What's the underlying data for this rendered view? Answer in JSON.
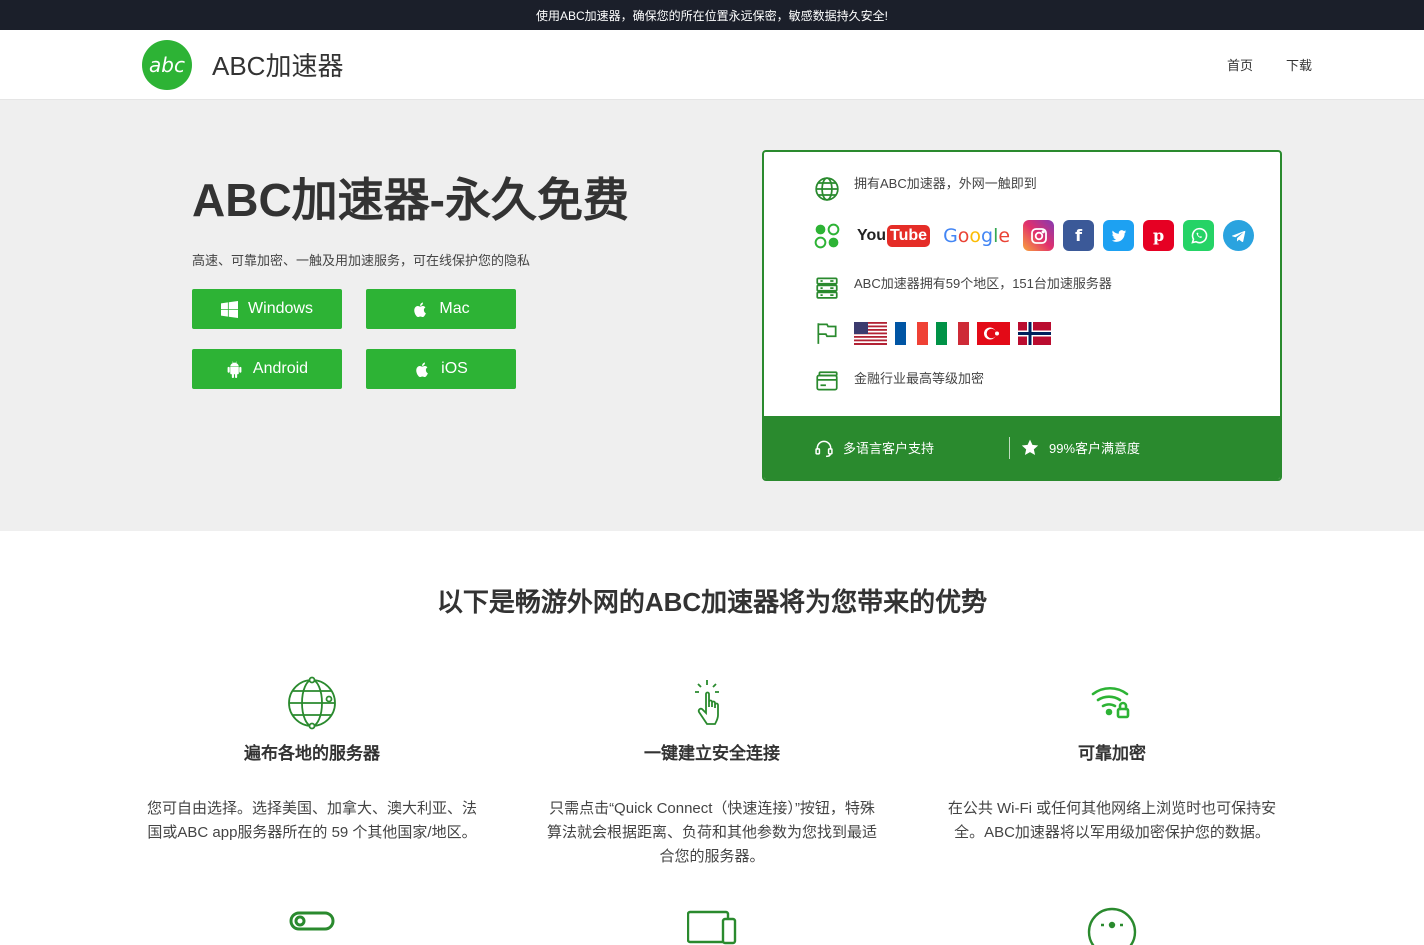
{
  "topbar": {
    "text": "使用ABC加速器，确保您的所在位置永远保密，敏感数据持久安全!"
  },
  "header": {
    "logo_text": "abc",
    "brand": "ABC加速器",
    "nav": [
      {
        "label": "首页"
      },
      {
        "label": "下载"
      }
    ]
  },
  "hero": {
    "title": "ABC加速器-永久免费",
    "subtitle": "高速、可靠加密、一触及用加速服务，可在线保护您的隐私",
    "buttons": [
      {
        "label": "Windows",
        "icon": "windows-icon"
      },
      {
        "label": "Mac",
        "icon": "apple-icon"
      },
      {
        "label": "Android",
        "icon": "android-icon"
      },
      {
        "label": "iOS",
        "icon": "apple-icon"
      }
    ]
  },
  "card": {
    "feature1": "拥有ABC加速器，外网一触即到",
    "social": [
      "YouTube",
      "Google",
      "Instagram",
      "Facebook",
      "Twitter",
      "Pinterest",
      "WhatsApp",
      "Telegram"
    ],
    "youtube_you": "You",
    "youtube_tube": "Tube",
    "google": "Google",
    "feature2": "ABC加速器拥有59个地区，151台加速服务器",
    "flags": [
      "us",
      "fr",
      "it",
      "tr",
      "no"
    ],
    "feature3": "金融行业最高等级加密",
    "footer": [
      {
        "label": "多语言客户支持"
      },
      {
        "label": "99%客户满意度"
      }
    ]
  },
  "benefits": {
    "title": "以下是畅游外网的ABC加速器将为您带来的优势",
    "items": [
      {
        "title": "遍布各地的服务器",
        "text": "您可自由选择。选择美国、加拿大、澳大利亚、法国或ABC app服务器所在的 59 个其他国家/地区。",
        "icon": "globe-icon"
      },
      {
        "title": "一键建立安全连接",
        "text": "只需点击“Quick Connect（快速连接）”按钮，特殊算法就会根据距离、负荷和其他参数为您找到最适合您的服务器。",
        "icon": "tap-icon"
      },
      {
        "title": "可靠加密",
        "text": "在公共 Wi-Fi 或任何其他网络上浏览时也可保持安全。ABC加速器将以军用级加密保护您的数据。",
        "icon": "wifi-lock-icon"
      }
    ]
  },
  "colors": {
    "accent": "#2db335",
    "dark_green": "#2a8a2e",
    "topbar": "#1b1f2a"
  }
}
